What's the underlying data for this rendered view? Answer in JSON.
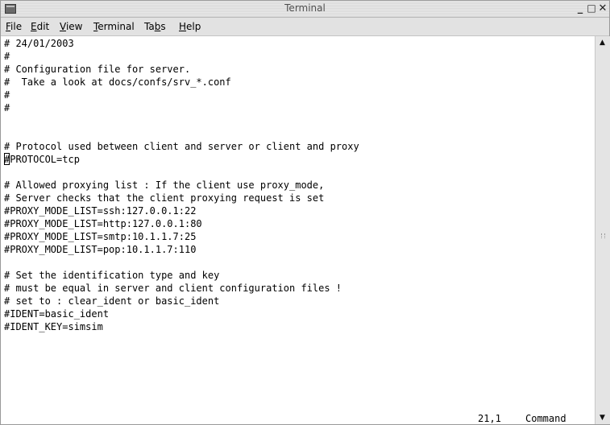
{
  "window": {
    "title": "Terminal",
    "controls": {
      "minimize": "_",
      "maximize": "□",
      "close": "✕"
    }
  },
  "menu": [
    {
      "label": "File",
      "mnemonic": "F",
      "rest": "ile"
    },
    {
      "label": "Edit",
      "mnemonic": "E",
      "rest": "dit"
    },
    {
      "label": "View",
      "mnemonic": "V",
      "rest": "iew"
    },
    {
      "label": "Terminal",
      "mnemonic": "T",
      "rest": "erminal"
    },
    {
      "label": "Tabs",
      "pre": "Ta",
      "mnemonic": "b",
      "rest": "s"
    },
    {
      "label": "Help",
      "mnemonic": "H",
      "rest": "elp"
    }
  ],
  "terminal": {
    "lines": [
      "# 24/01/2003",
      "#",
      "# Configuration file for server.",
      "#  Take a look at docs/confs/srv_*.conf",
      "#",
      "#",
      "",
      "",
      "# Protocol used between client and server or client and proxy",
      "#PROTOCOL=tcp",
      "",
      "# Allowed proxying list : If the client use proxy_mode,",
      "# Server checks that the client proxying request is set",
      "#PROXY_MODE_LIST=ssh:127.0.0.1:22",
      "#PROXY_MODE_LIST=http:127.0.0.1:80",
      "#PROXY_MODE_LIST=smtp:10.1.1.7:25",
      "#PROXY_MODE_LIST=pop:10.1.1.7:110",
      "",
      "# Set the identification type and key",
      "# must be equal in server and client configuration files !",
      "# set to : clear_ident or basic_ident",
      "#IDENT=basic_ident",
      "#IDENT_KEY=simsim"
    ],
    "cursor_line": 10,
    "status_position": "21,1",
    "status_mode": "Command"
  },
  "scrollbar": {
    "up_arrow": "▲",
    "down_arrow": "▼"
  }
}
